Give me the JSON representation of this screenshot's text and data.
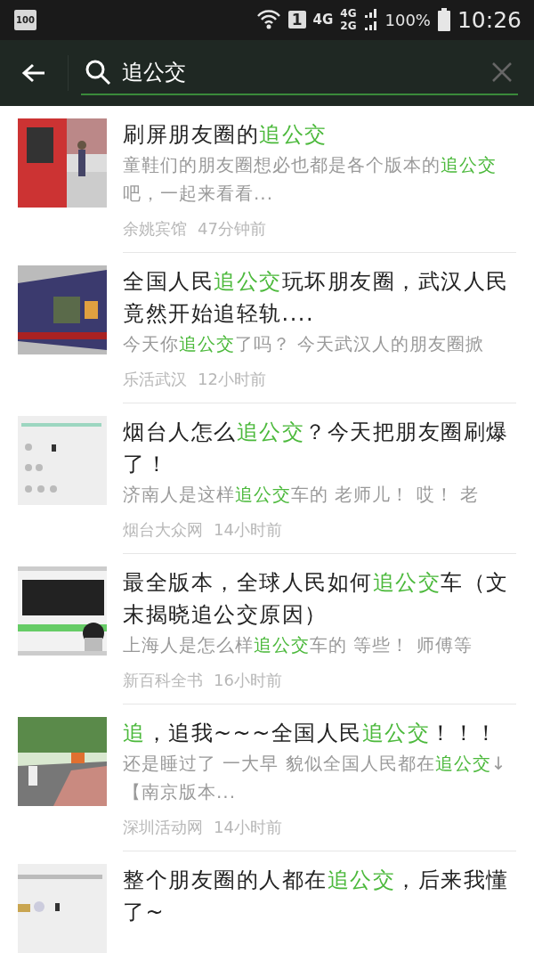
{
  "status_bar": {
    "battery_badge": "100",
    "sim_slot": "1",
    "network_1": "4G",
    "network_2": "4G",
    "network_3": "2G",
    "battery_percent": "100%",
    "time": "10:26"
  },
  "search_bar": {
    "value": "追公交"
  },
  "results": [
    {
      "thumbnail": {
        "kind": "picture"
      },
      "title": [
        {
          "text": "刷屏朋友圈的",
          "highlight": false
        },
        {
          "text": "追公交",
          "highlight": true
        }
      ],
      "snippet": [
        {
          "text": "童鞋们的朋友圈想必也都是各个版本的",
          "highlight": false
        },
        {
          "text": "追公交",
          "highlight": true
        },
        {
          "text": "吧，一起来看看...",
          "highlight": false
        }
      ],
      "source": "余姚宾馆",
      "time": "47分钟前"
    },
    {
      "thumbnail": {
        "kind": "picture"
      },
      "title": [
        {
          "text": "全国人民",
          "highlight": false
        },
        {
          "text": "追公交",
          "highlight": true
        },
        {
          "text": "玩坏朋友圈，武汉人民竟然开始追轻轨....",
          "highlight": false
        }
      ],
      "snippet": [
        {
          "text": "今天你",
          "highlight": false
        },
        {
          "text": "追公交",
          "highlight": true
        },
        {
          "text": "了吗？ 今天武汉人的朋友圈掀",
          "highlight": false
        }
      ],
      "source": "乐活武汉",
      "time": "12小时前"
    },
    {
      "thumbnail": {
        "kind": "picture"
      },
      "title": [
        {
          "text": "烟台人怎么",
          "highlight": false
        },
        {
          "text": "追公交",
          "highlight": true
        },
        {
          "text": "？今天把朋友圈刷爆了！",
          "highlight": false
        }
      ],
      "snippet": [
        {
          "text": "济南人是这样",
          "highlight": false
        },
        {
          "text": "追公交",
          "highlight": true
        },
        {
          "text": "车的 老师儿！ 哎！ 老",
          "highlight": false
        }
      ],
      "source": "烟台大众网",
      "time": "14小时前"
    },
    {
      "thumbnail": {
        "kind": "picture"
      },
      "title": [
        {
          "text": "最全版本，全球人民如何",
          "highlight": false
        },
        {
          "text": "追公交",
          "highlight": true
        },
        {
          "text": "车（文末揭晓追公交原因）",
          "highlight": false
        }
      ],
      "snippet": [
        {
          "text": "上海人是怎么样",
          "highlight": false
        },
        {
          "text": "追公交",
          "highlight": true
        },
        {
          "text": "车的 等些！ 师傅等",
          "highlight": false
        }
      ],
      "source": "新百科全书",
      "time": "16小时前"
    },
    {
      "thumbnail": {
        "kind": "picture"
      },
      "title": [
        {
          "text": "追",
          "highlight": true
        },
        {
          "text": "，追我~~~全国人民",
          "highlight": false
        },
        {
          "text": "追公交",
          "highlight": true
        },
        {
          "text": "！！！",
          "highlight": false
        }
      ],
      "snippet": [
        {
          "text": "还是睡过了 一大早 貌似全国人民都在",
          "highlight": false
        },
        {
          "text": "追公交",
          "highlight": true
        },
        {
          "text": "↓【南京版本...",
          "highlight": false
        }
      ],
      "source": "深圳活动网",
      "time": "14小时前"
    },
    {
      "thumbnail": {
        "kind": "picture"
      },
      "title": [
        {
          "text": "整个朋友圈的人都在",
          "highlight": false
        },
        {
          "text": "追公交",
          "highlight": true
        },
        {
          "text": "，后来我懂了~",
          "highlight": false
        }
      ]
    }
  ]
}
